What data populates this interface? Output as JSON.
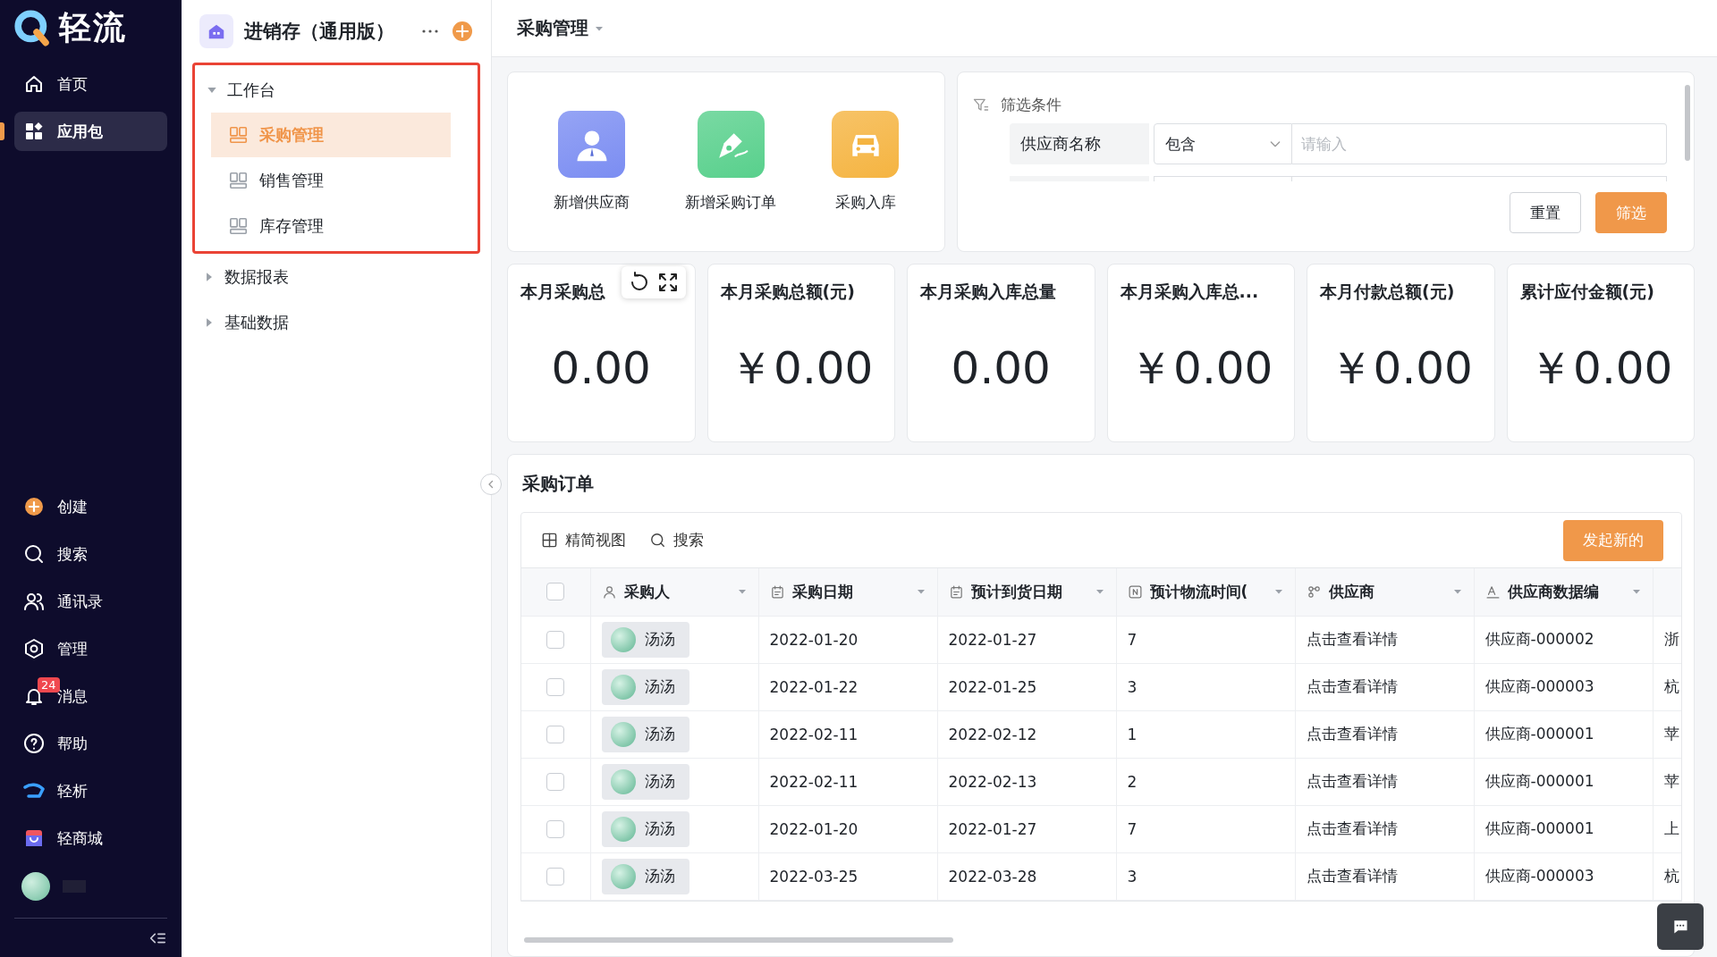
{
  "sidebar": {
    "logo": "轻流",
    "top_items": [
      {
        "label": "首页",
        "selected": false
      },
      {
        "label": "应用包",
        "selected": true
      }
    ],
    "bottom_items": [
      {
        "label": "创建"
      },
      {
        "label": "搜索"
      },
      {
        "label": "通讯录"
      },
      {
        "label": "管理"
      },
      {
        "label": "消息",
        "badge": "24"
      },
      {
        "label": "帮助"
      },
      {
        "label": "轻析"
      },
      {
        "label": "轻商城"
      }
    ]
  },
  "app_nav": {
    "title": "进销存（通用版）",
    "tree": [
      {
        "label": "工作台",
        "expanded": true,
        "children": [
          {
            "label": "采购管理",
            "selected": true
          },
          {
            "label": "销售管理",
            "selected": false
          },
          {
            "label": "库存管理",
            "selected": false
          }
        ]
      },
      {
        "label": "数据报表",
        "expanded": false
      },
      {
        "label": "基础数据",
        "expanded": false
      }
    ]
  },
  "header": {
    "title": "采购管理"
  },
  "quick_actions": [
    {
      "label": "新增供应商",
      "color": "#7b8df2"
    },
    {
      "label": "新增采购订单",
      "color": "#58d08c"
    },
    {
      "label": "采购入库",
      "color": "#f5b441"
    }
  ],
  "filter": {
    "title": "筛选条件",
    "field": "供应商名称",
    "operator": "包含",
    "placeholder": "请输入",
    "buttons": [
      {
        "label": "重置",
        "kind": "secondary"
      },
      {
        "label": "筛选",
        "kind": "primary"
      }
    ]
  },
  "stats": [
    {
      "title": "本月采购总",
      "value": "0.00",
      "toolbar": true
    },
    {
      "title": "本月采购总额(元)",
      "value": "￥0.00"
    },
    {
      "title": "本月采购入库总量",
      "value": "0.00"
    },
    {
      "title": "本月采购入库总...",
      "value": "￥0.00"
    },
    {
      "title": "本月付款总额(元)",
      "value": "￥0.00"
    },
    {
      "title": "累计应付金额(元)",
      "value": "￥0.00"
    }
  ],
  "orders": {
    "title": "采购订单",
    "toolbar": [
      "精简视图",
      "搜索"
    ],
    "new_button": "发起新的",
    "all_checked": false,
    "columns": [
      {
        "label": "采购人",
        "kind": "member"
      },
      {
        "label": "采购日期",
        "kind": "date"
      },
      {
        "label": "预计到货日期",
        "kind": "date"
      },
      {
        "label": "预计物流时间(",
        "kind": "number"
      },
      {
        "label": "供应商",
        "kind": "relation"
      },
      {
        "label": "供应商数据编",
        "kind": "text"
      },
      {
        "kind": "blank"
      }
    ],
    "rows": [
      {
        "checked": false,
        "cells": [
          "汤汤",
          "2022-01-20",
          "2022-01-27",
          "7",
          "点击查看详情",
          "供应商-000002",
          "浙"
        ]
      },
      {
        "checked": false,
        "cells": [
          "汤汤",
          "2022-01-22",
          "2022-01-25",
          "3",
          "点击查看详情",
          "供应商-000003",
          "杭"
        ]
      },
      {
        "checked": false,
        "cells": [
          "汤汤",
          "2022-02-11",
          "2022-02-12",
          "1",
          "点击查看详情",
          "供应商-000001",
          "苹"
        ]
      },
      {
        "checked": false,
        "cells": [
          "汤汤",
          "2022-02-11",
          "2022-02-13",
          "2",
          "点击查看详情",
          "供应商-000001",
          "苹"
        ]
      },
      {
        "checked": false,
        "cells": [
          "汤汤",
          "2022-01-20",
          "2022-01-27",
          "7",
          "点击查看详情",
          "供应商-000001",
          "上"
        ]
      },
      {
        "checked": false,
        "cells": [
          "汤汤",
          "2022-03-25",
          "2022-03-28",
          "3",
          "点击查看详情",
          "供应商-000003",
          "杭"
        ]
      }
    ]
  }
}
